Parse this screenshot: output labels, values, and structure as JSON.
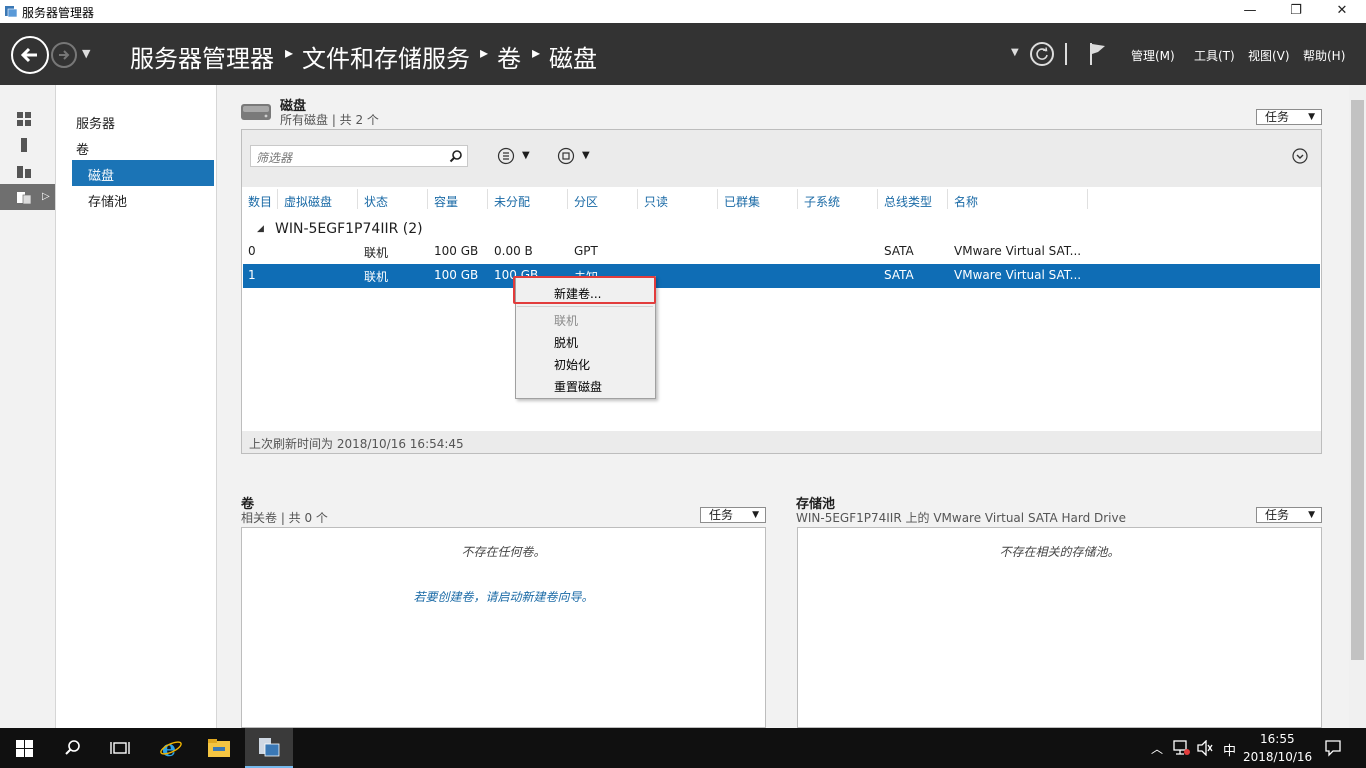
{
  "window": {
    "title": "服务器管理器",
    "min": "—",
    "max": "❐",
    "close": "✕"
  },
  "header": {
    "breadcrumb": [
      "服务器管理器",
      "文件和存储服务",
      "卷",
      "磁盘"
    ],
    "menus": [
      "管理(M)",
      "工具(T)",
      "视图(V)",
      "帮助(H)"
    ]
  },
  "nav": {
    "items": [
      "服务器",
      "卷",
      "磁盘",
      "存储池"
    ],
    "selected": "磁盘"
  },
  "disks": {
    "title": "磁盘",
    "subtitle": "所有磁盘 | 共 2 个",
    "tasks_label": "任务",
    "filter_placeholder": "筛选器",
    "columns": [
      "数目",
      "虚拟磁盘",
      "状态",
      "容量",
      "未分配",
      "分区",
      "只读",
      "已群集",
      "子系统",
      "总线类型",
      "名称"
    ],
    "group_label": "WIN-5EGF1P74IIR (2)",
    "rows": [
      {
        "num": "0",
        "status": "联机",
        "capacity": "100 GB",
        "unalloc": "0.00 B",
        "partition": "GPT",
        "bus": "SATA",
        "name": "VMware Virtual SAT..."
      },
      {
        "num": "1",
        "status": "联机",
        "capacity": "100 GB",
        "unalloc": "100 GB",
        "partition": "未知",
        "bus": "SATA",
        "name": "VMware Virtual SAT..."
      }
    ],
    "footer": "上次刷新时间为 2018/10/16 16:54:45"
  },
  "context_menu": {
    "items": [
      "新建卷...",
      "联机",
      "脱机",
      "初始化",
      "重置磁盘"
    ],
    "disabled": [
      "联机"
    ]
  },
  "volumes": {
    "title": "卷",
    "subtitle": "相关卷 | 共 0 个",
    "tasks_label": "任务",
    "empty_msg": "不存在任何卷。",
    "hint": "若要创建卷，请启动新建卷向导。"
  },
  "pools": {
    "title": "存储池",
    "subtitle": "WIN-5EGF1P74IIR 上的 VMware Virtual SATA Hard Drive",
    "tasks_label": "任务",
    "empty_msg": "不存在相关的存储池。"
  },
  "taskbar": {
    "time": "16:55",
    "date": "2018/10/16",
    "ime": "中"
  },
  "colors": {
    "header_bg": "#333333",
    "selection": "#0f6db5",
    "nav_selected": "#1b74b6",
    "link_blue": "#1a6aa6",
    "highlight_red": "#e23c3c"
  }
}
